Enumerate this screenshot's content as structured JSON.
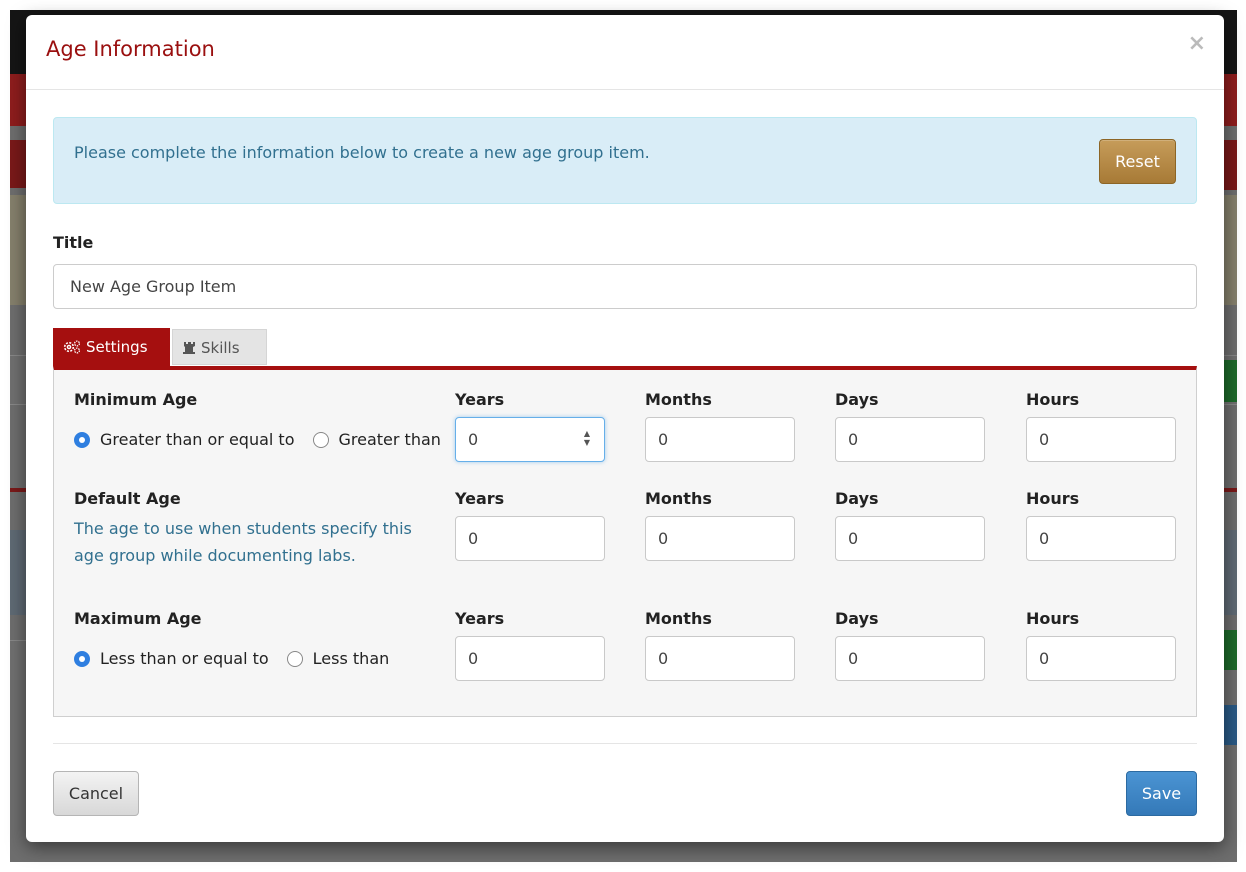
{
  "modal": {
    "title": "Age Information",
    "close_label": "×",
    "alert_text": "Please complete the information below to create a new age group item.",
    "reset_label": "Reset",
    "title_field_label": "Title",
    "title_field_value": "New Age Group Item",
    "tabs": [
      {
        "label": "Settings",
        "icon": "gears-icon",
        "active": true
      },
      {
        "label": "Skills",
        "icon": "chess-rook-icon",
        "active": false
      }
    ],
    "minimum_age": {
      "label": "Minimum Age",
      "options": [
        {
          "label": "Greater than or equal to",
          "checked": true
        },
        {
          "label": "Greater than",
          "checked": false
        }
      ]
    },
    "default_age": {
      "label": "Default Age",
      "help_text": "The age to use when students specify this age group while documenting labs."
    },
    "maximum_age": {
      "label": "Maximum Age",
      "options": [
        {
          "label": "Less than or equal to",
          "checked": true
        },
        {
          "label": "Less than",
          "checked": false
        }
      ]
    },
    "columns": [
      "Years",
      "Months",
      "Days",
      "Hours"
    ],
    "values": {
      "minimum": [
        "0",
        "0",
        "0",
        "0"
      ],
      "default": [
        "0",
        "0",
        "0",
        "0"
      ],
      "maximum": [
        "0",
        "0",
        "0",
        "0"
      ]
    },
    "cancel_label": "Cancel",
    "save_label": "Save"
  },
  "colors": {
    "brand_red": "#a50f0f",
    "title_red": "#9a0f0f",
    "alert_bg": "#d9edf7",
    "alert_text": "#31708f",
    "reset_button": "#b88a46",
    "save_button": "#3d86c6"
  }
}
